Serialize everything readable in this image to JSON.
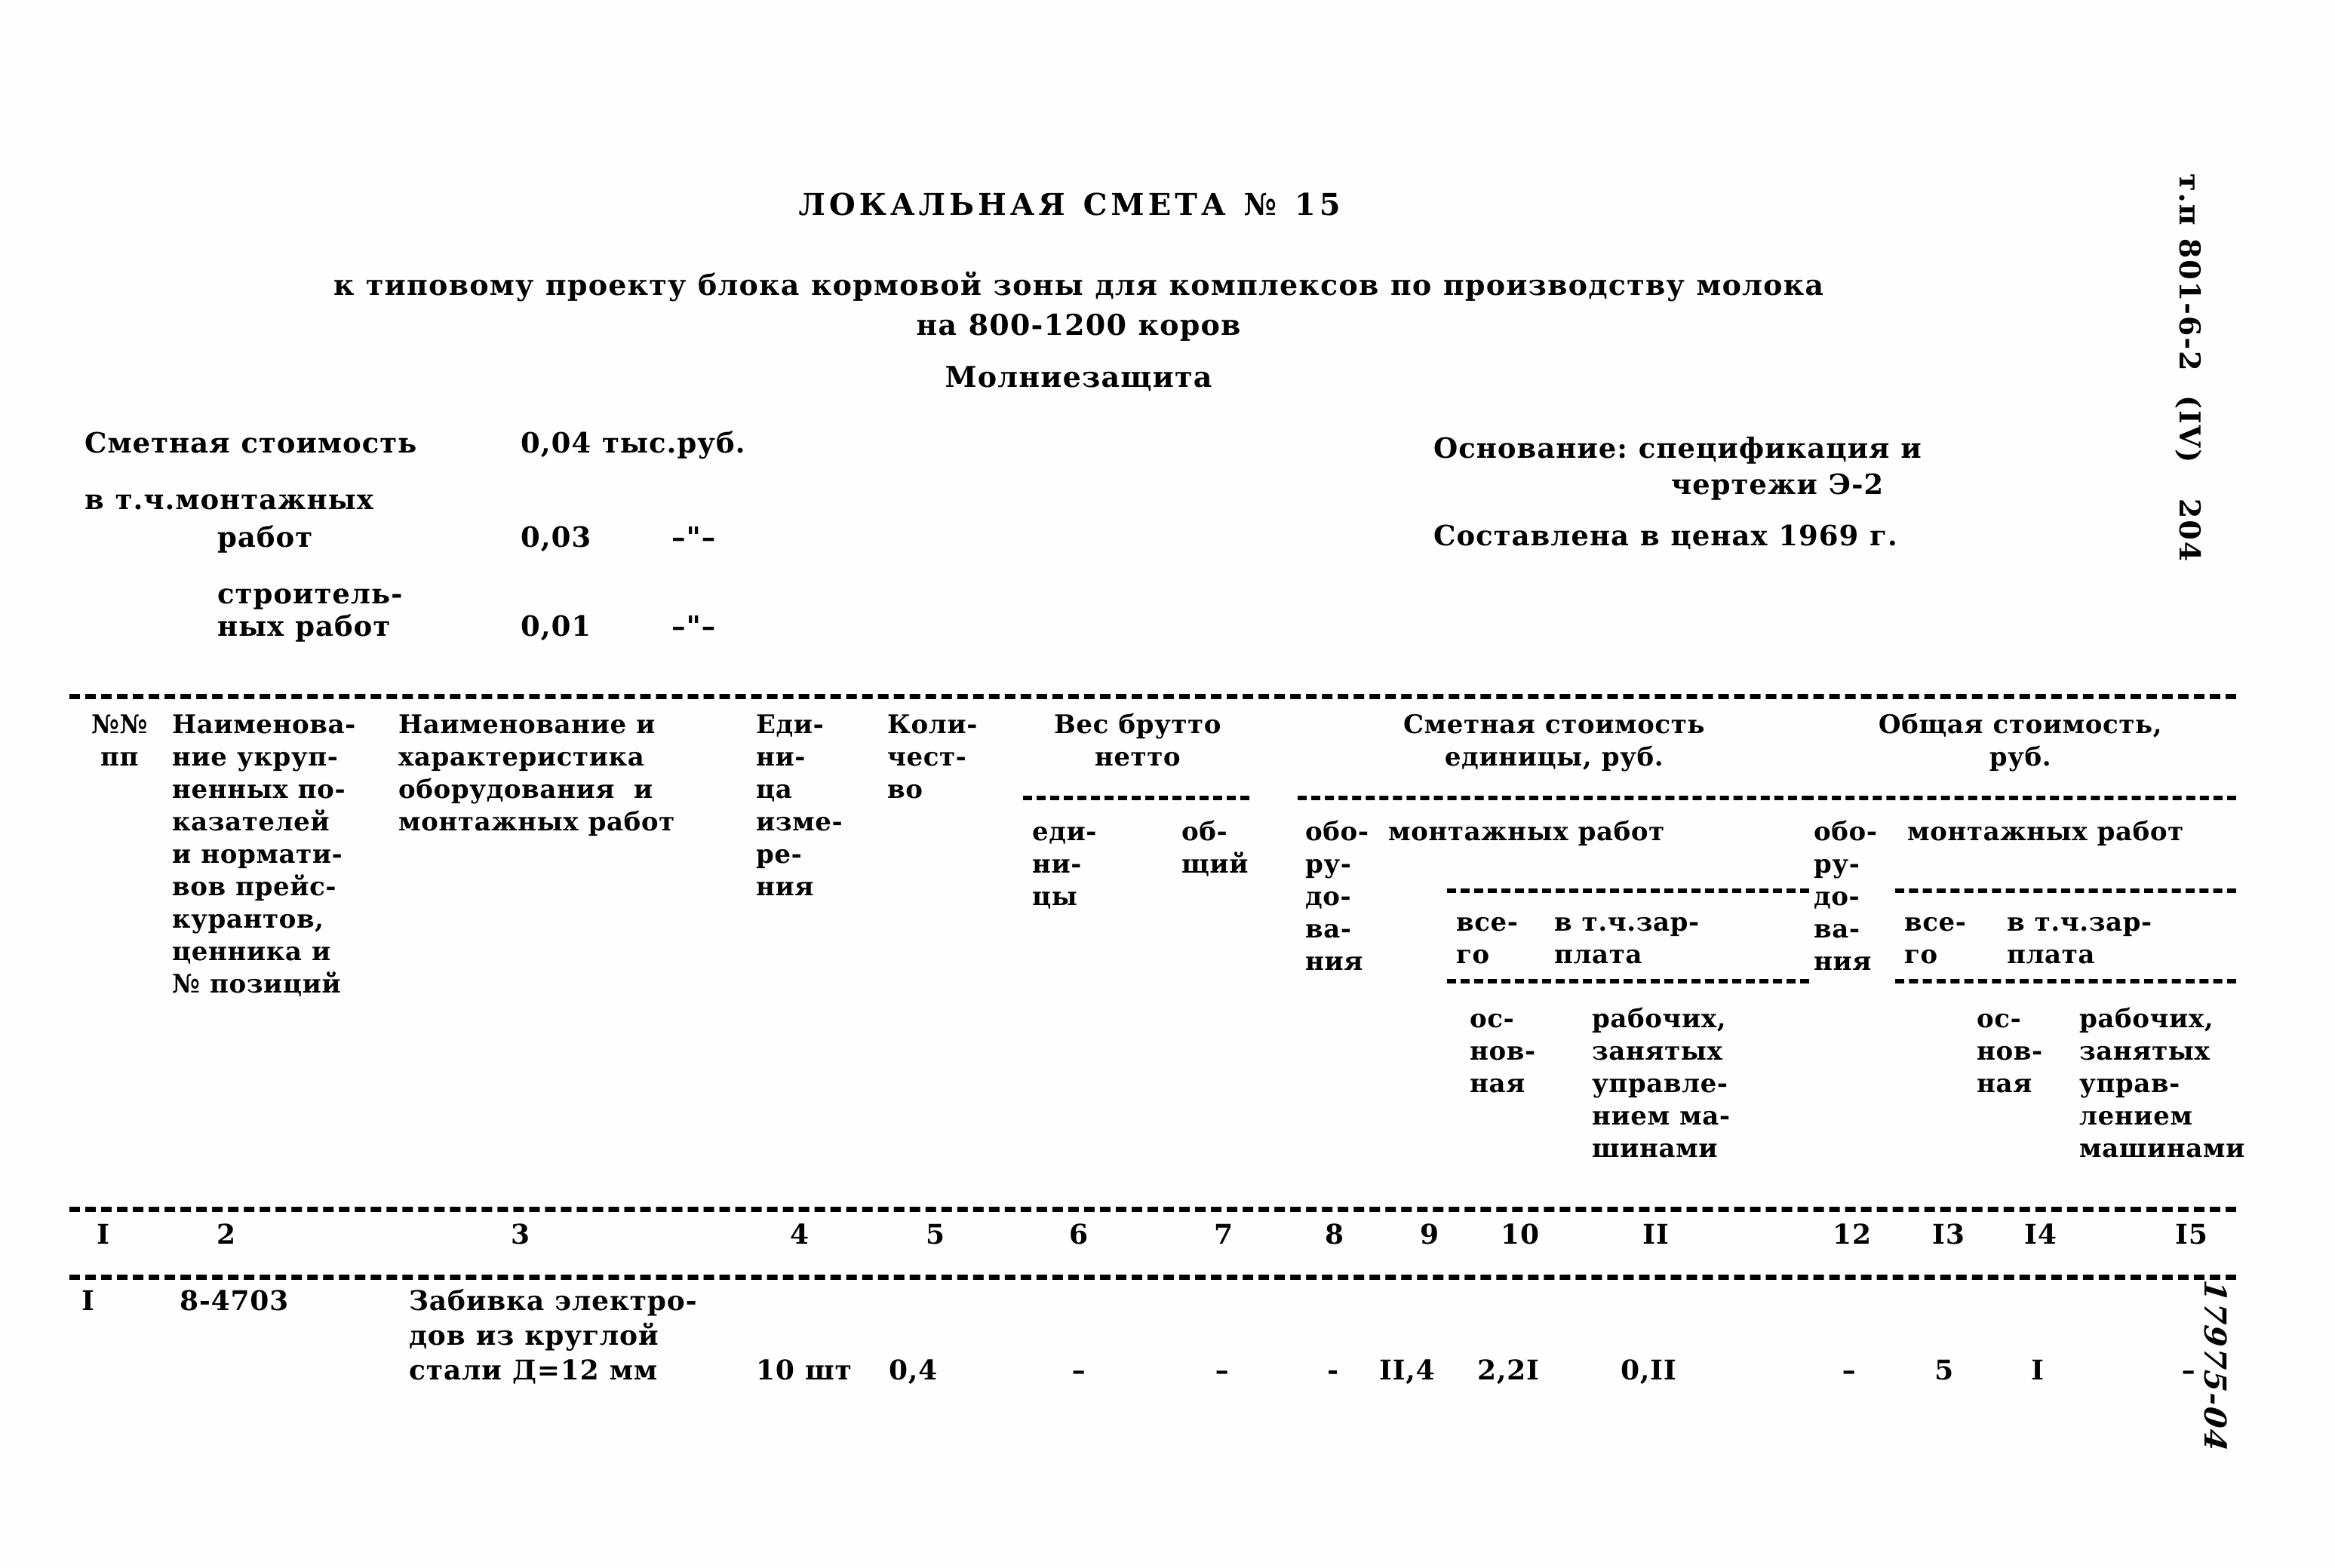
{
  "document": {
    "title": "ЛОКАЛЬНАЯ СМЕТА № 15",
    "subtitle_line_1": "к типовому проекту блока кормовой зоны для комплексов по производству молока",
    "subtitle_line_2": "на 800-1200 коров",
    "subtitle_line_3": "Молниезащита",
    "side_code": "т.п 801-6-2  (IV)   204",
    "corner_stamp": "17975-04"
  },
  "cost_summary": {
    "total_label": "Сметная стоимость",
    "total_value": "0,04 тыс.руб.",
    "including_label": "в т.ч.монтажных",
    "mounting_label": "работ",
    "mounting_value": "0,03",
    "mounting_unit": "–\"–",
    "construction_label_1": "строитель-",
    "construction_label_2": "ных работ",
    "construction_value": "0,01",
    "construction_unit": "–\"–"
  },
  "basis": {
    "line_1": "Основание: спецификация и",
    "line_2": "чертежи Э-2",
    "line_3": "Составлена в ценах 1969 г."
  },
  "table": {
    "headers": {
      "col1": "№№\nпп",
      "col2": "Наименова-\nние укруп-\nненных по-\nказателей\nи нормати-\nвов прейс-\nкурантов,\nценника и\n№ позиций",
      "col3": "Наименование и\nхарактеристика\nоборудования  и\nмонтажных работ",
      "col4": "Еди-\nни-\nца\nизме-\nре-\nния",
      "col5": "Коли-\nчест-\nво",
      "group_weight": "Вес брутто\nнетто",
      "col6": "еди-\nни-\nцы",
      "col7": "об-\nщий",
      "group_unit_cost": "Сметная стоимость\nединицы, руб.",
      "col8": "обо-\nру-\nдо-\nва-\nния",
      "group_unit_mounting": "монтажных работ",
      "col9": "все-\nго",
      "col10_11": "в т.ч.зар-\nплата",
      "col10": "ос-\nнов-\nная",
      "col11": "рабочих,\nзанятых\nуправле-\nнием ма-\nшинами",
      "group_total_cost": "Общая стоимость,\nруб.",
      "col12": "обо-\nру-\nдо-\nва-\nния",
      "group_total_mounting": "монтажных работ",
      "col13": "все-\nго",
      "col14_15": "в т.ч.зар-\nплата",
      "col14": "ос-\nнов-\nная",
      "col15": "рабочих,\nзанятых\nуправ-\nлением\nмашинами"
    },
    "column_numbers": [
      "I",
      "2",
      "3",
      "4",
      "5",
      "6",
      "7",
      "8",
      "9",
      "10",
      "II",
      "12",
      "I3",
      "I4",
      "I5"
    ],
    "rows": [
      {
        "col1": "I",
        "col2": "8-4703",
        "col3": "Забивка электро-\nдов из круглой\nстали Д=12 мм",
        "col4": "10 шт",
        "col5": "0,4",
        "col6": "–",
        "col7": "–",
        "col8": "-",
        "col9": "II,4",
        "col10": "2,2I",
        "col11": "0,II",
        "col12": "–",
        "col13": "5",
        "col14": "I",
        "col15": "–"
      }
    ]
  }
}
